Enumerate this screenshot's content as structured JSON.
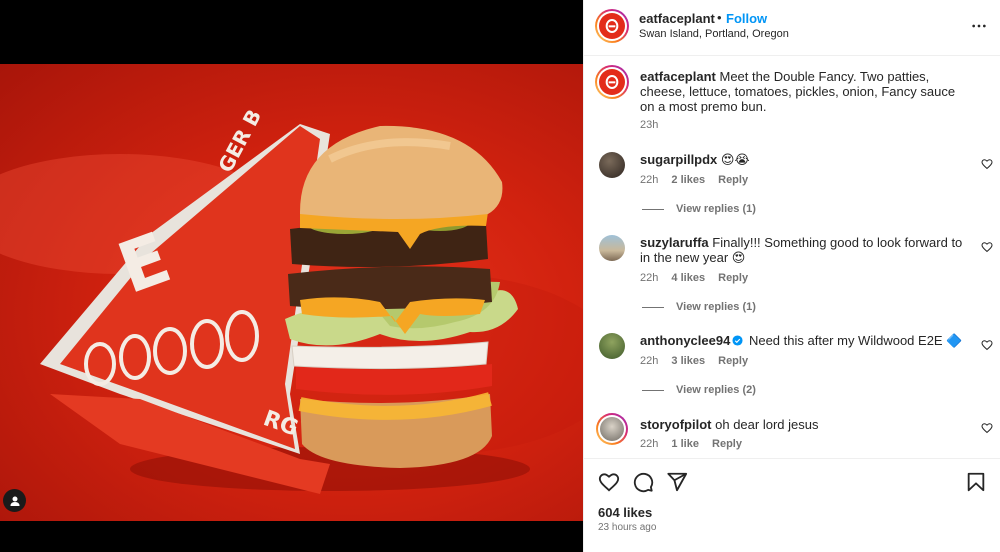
{
  "header": {
    "username": "eatfaceplant",
    "separator": "•",
    "follow_label": "Follow",
    "location": "Swan Island, Portland, Oregon"
  },
  "caption": {
    "username": "eatfaceplant",
    "text": "Meet the Double Fancy. Two patties, cheese, lettuce, tomatoes, pickles, onion, Fancy sauce on a most premo bun.",
    "time": "23h"
  },
  "comments": [
    {
      "username": "sugarpillpdx",
      "text": "😍😭",
      "time": "22h",
      "likes": "2 likes",
      "reply": "Reply",
      "view_replies": "View replies (1)"
    },
    {
      "username": "suzylaruffa",
      "text": "Finally!!! Something good to look forward to in the new year 😍",
      "time": "22h",
      "likes": "4 likes",
      "reply": "Reply",
      "view_replies": "View replies (1)"
    },
    {
      "username": "anthonyclee94",
      "text": "Need this after my Wildwood E2E 🔷",
      "time": "22h",
      "likes": "3 likes",
      "reply": "Reply",
      "view_replies": "View replies (2)"
    },
    {
      "username": "storyofpilot",
      "text": "oh dear lord jesus",
      "time": "22h",
      "likes": "1 like",
      "reply": "Reply"
    }
  ],
  "footer": {
    "likes": "604 likes",
    "posted": "23 hours ago"
  },
  "icons": {
    "more": "more-horizontal-icon",
    "like": "heart-icon",
    "comment": "comment-icon",
    "share": "paper-plane-icon",
    "save": "bookmark-icon",
    "tag": "user-tag-icon",
    "verified": "verified-badge-icon"
  },
  "colors": {
    "accent": "#0095f6",
    "brand_red": "#e32c1a",
    "secondary_text": "#737373",
    "verified": "#0095f6"
  }
}
